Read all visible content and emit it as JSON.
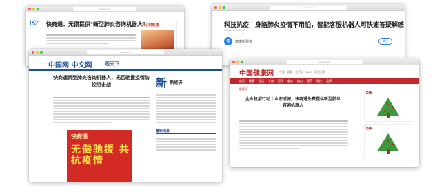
{
  "windows": [
    {
      "id": "w1",
      "url": "gaoqie.com",
      "site_logo": "iKr",
      "title": "快商通：无偿提供“新型肺炎咨询机器人”",
      "ad_header": "24小时热搜"
    },
    {
      "id": "w2",
      "url": "gaoqie.com",
      "title": "科技抗疫｜身陷肺炎疫情不用怕，智能客服机器人可快速答疑解惑",
      "date": "2020-02-05 13:25",
      "source_name": "健康新科技",
      "source_logo": "健",
      "follow_label": "关注"
    },
    {
      "id": "w3",
      "url": "gaoqie.com",
      "masthead": "中国网 中文网",
      "section": "观天下",
      "article_title": "快商通新型肺炎咨询机器人，无偿驰援疫情防控阻击战",
      "poster_brand": "快商通",
      "poster_text": "无偿驰援 共抗疫情",
      "side_logo": "新",
      "side_brand": "新经济",
      "side_heading": "最新消息"
    },
    {
      "id": "w4",
      "url": "gaoqie.com",
      "masthead": "中国健康网",
      "tagline": "中国 · 健康 · 生活网 · 2020 · 新型冠状",
      "nav": [
        "首页",
        "健康",
        "生活",
        "人物",
        "资讯",
        "临床",
        "热点",
        "医药",
        "科技",
        "品牌"
      ],
      "crumb": "健康号",
      "article_title": "企业抗疫行动｜众志成城，快商通免费提供新型肺炎咨询机器人",
      "card_heading": "疫情"
    }
  ]
}
